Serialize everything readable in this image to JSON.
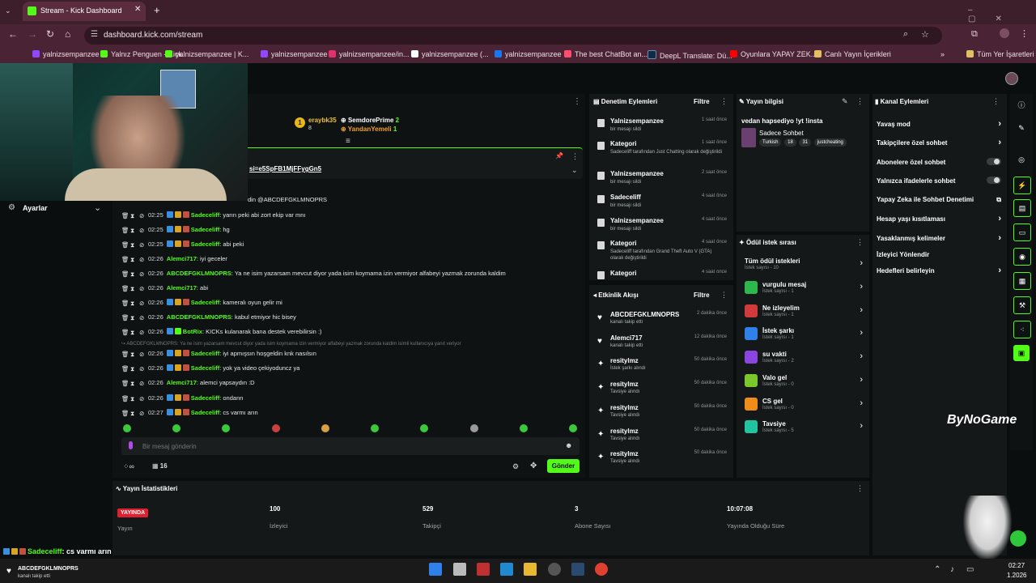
{
  "browser": {
    "tab_title": "Stream - Kick Dashboard",
    "url": "dashboard.kick.com/stream",
    "bookmarks": [
      {
        "label": "yalnizsempanzee",
        "color": "#9146ff"
      },
      {
        "label": "Yalnız Penguen - Kick",
        "color": "#53fc18"
      },
      {
        "label": "yalnizsempanzee | K...",
        "color": "#53fc18"
      },
      {
        "label": "yalnizsempanzee",
        "color": "#9146ff"
      },
      {
        "label": "yalnizsempanzee/in...",
        "color": "#e1306c"
      },
      {
        "label": "yalnizsempanzee (...",
        "color": "#ffffff"
      },
      {
        "label": "yalnizsempanzee",
        "color": "#1877f2"
      },
      {
        "label": "The best ChatBot an...",
        "color": "#ff4d6d"
      },
      {
        "label": "DeepL Translate: Dü...",
        "color": "#0f2b46"
      },
      {
        "label": "Oyunlara YAPAY ZEK...",
        "color": "#ff0000"
      },
      {
        "label": "Canlı Yayın İçerikleri",
        "color": "#e0c060"
      }
    ],
    "all_bookmarks": "Tüm Yer İşaretleri"
  },
  "left_panel": {
    "settings": "Ayarlar"
  },
  "chat": {
    "top_gifters": [
      {
        "name": "eraybk35",
        "count": "8",
        "color": "#e8c03a"
      },
      {
        "name": "SemdorePrime",
        "count": "2",
        "color": "#ffffff"
      },
      {
        "name": "YandanYemeli",
        "count": "1",
        "color": "#f0a030"
      }
    ],
    "pinned_link": "si=e5SpFB1MjFFygGn5",
    "reply_line": "din @ABCDEFGKLMNOPRS",
    "messages": [
      {
        "time": "02:25",
        "user": "Sadeceliff",
        "color": "#53fc18",
        "text": ": yarın peki abi zort ekip var mnı"
      },
      {
        "time": "02:25",
        "user": "Sadeceliff",
        "color": "#53fc18",
        "text": ": hg"
      },
      {
        "time": "02:25",
        "user": "Sadeceliff",
        "color": "#53fc18",
        "text": ": abi peki"
      },
      {
        "time": "02:26",
        "user": "Alemci717",
        "color": "#53fc18",
        "text": ": iyi geceler"
      },
      {
        "time": "02:26",
        "user": "ABCDEFGKLMNOPRS",
        "color": "#53fc18",
        "text": ": Ya ne isim yazarsam mevcut diyor yada isim koymama izin vermiyor alfabeyi yazmak zorunda kaldim"
      },
      {
        "time": "02:26",
        "user": "Alemci717",
        "color": "#53fc18",
        "text": ": abi"
      },
      {
        "time": "02:26",
        "user": "Sadeceliff",
        "color": "#53fc18",
        "text": ": kameralı oyun gelir mi"
      },
      {
        "time": "02:26",
        "user": "ABCDEFGKLMNOPRS",
        "color": "#53fc18",
        "text": ": kabul etmiyor hic bisey"
      },
      {
        "time": "02:26",
        "user": "BotRix",
        "color": "#53fc18",
        "text": ": KICKs kulanarak bana destek verebilirsin :)"
      },
      {
        "time": "02:26",
        "user": "Sadeceliff",
        "color": "#53fc18",
        "text": ": iyi apmışsın hoşgeldin knk nasılsın"
      },
      {
        "time": "02:26",
        "user": "Sadeceliff",
        "color": "#53fc18",
        "text": ": yok ya video çekiyoduncz ya"
      },
      {
        "time": "02:26",
        "user": "Alemci717",
        "color": "#53fc18",
        "text": ": alemci yapsaydın :D"
      },
      {
        "time": "02:26",
        "user": "Sadeceliff",
        "color": "#53fc18",
        "text": ": ondann"
      },
      {
        "time": "02:27",
        "user": "Sadeceliff",
        "color": "#53fc18",
        "text": ": cs varmı arın"
      }
    ],
    "reply_context": "ABCDEFGKLMNOPRS: Ya ne isim yazarsam mevcut diyor yada isim koymama izin vermiyor alfabeyi yazmak zorunda kaldim isimli kullanıcıya yanıt veriyor",
    "input_placeholder": "Bir mesaj gönderin",
    "viewer_count": "16",
    "send_label": "Gönder"
  },
  "moderation": {
    "title": "Denetim Eylemleri",
    "filter": "Filtre",
    "items": [
      {
        "user": "Yalnizsempanzee",
        "time": "1 saat önce",
        "desc": "bir mesajı sildi",
        "type": "trash"
      },
      {
        "user": "Kategori",
        "time": "1 saat önce",
        "desc": "Sadeceliff tarafından Just Chatting olarak değiştirildi",
        "type": "cat"
      },
      {
        "user": "Yalnizsempanzee",
        "time": "2 saat önce",
        "desc": "bir mesajı sildi",
        "type": "trash"
      },
      {
        "user": "Sadeceliff",
        "time": "4 saat önce",
        "desc": "bir mesajı sildi",
        "type": "trash"
      },
      {
        "user": "Yalnizsempanzee",
        "time": "4 saat önce",
        "desc": "bir mesajı sildi",
        "type": "trash"
      },
      {
        "user": "Kategori",
        "time": "4 saat önce",
        "desc": "Sadeceliff tarafından Grand Theft Auto V (GTA) olarak değiştirildi",
        "type": "cat"
      },
      {
        "user": "Kategori",
        "time": "4 saat önce",
        "desc": "",
        "type": "cat"
      }
    ]
  },
  "activity": {
    "title": "Etkinlik Akışı",
    "filter": "Filtre",
    "items": [
      {
        "user": "ABCDEFGKLMNOPRS",
        "time": "2 dakika önce",
        "desc": "kanalı takip etti",
        "icon": "♥"
      },
      {
        "user": "Alemci717",
        "time": "12 dakika önce",
        "desc": "kanalı takip etti",
        "icon": "♥"
      },
      {
        "user": "resitylmz",
        "time": "50 dakika önce",
        "desc": "İstek şarkı alındı",
        "icon": "✦"
      },
      {
        "user": "resitylmz",
        "time": "50 dakika önce",
        "desc": "Tavsiye alındı",
        "icon": "✦"
      },
      {
        "user": "resitylmz",
        "time": "50 dakika önce",
        "desc": "Tavsiye alındı",
        "icon": "✦"
      },
      {
        "user": "resitylmz",
        "time": "50 dakika önce",
        "desc": "Tavsiye alındı",
        "icon": "✦"
      },
      {
        "user": "resitylmz",
        "time": "50 dakika önce",
        "desc": "Tavsiye alındı",
        "icon": "✦"
      }
    ]
  },
  "stream_info": {
    "title": "Yayın bilgisi",
    "stream_title": "vedan hapsediyo !yt !insta",
    "category": "Sadece Sohbet",
    "tags": [
      "Turkish",
      "18",
      "31",
      "justcheating"
    ]
  },
  "rewards": {
    "title": "Ödül istek sırası",
    "items": [
      {
        "name": "Tüm ödül istekleri",
        "desc": "İstek sayısı - 10",
        "color": ""
      },
      {
        "name": "vurgulu mesaj",
        "desc": "İstek sayısı - 1",
        "color": "#2db84d"
      },
      {
        "name": "Ne izleyelim",
        "desc": "İstek sayısı - 1",
        "color": "#d23b3b"
      },
      {
        "name": "İstek şarkı",
        "desc": "İstek sayısı - 1",
        "color": "#2f80e8"
      },
      {
        "name": "su vakti",
        "desc": "İstek sayısı - 2",
        "color": "#8b45e0"
      },
      {
        "name": "Valo gel",
        "desc": "İstek sayısı - 0",
        "color": "#7cc82a"
      },
      {
        "name": "CS gel",
        "desc": "İstek sayısı - 0",
        "color": "#f08c1a"
      },
      {
        "name": "Tavsiye",
        "desc": "İstek sayısı - 5",
        "color": "#22c4a0"
      }
    ]
  },
  "channel_actions": {
    "title": "Kanal Eylemleri",
    "items": [
      {
        "label": "Yavaş mod",
        "control": "arrow"
      },
      {
        "label": "Takipçilere özel sohbet",
        "control": "arrow"
      },
      {
        "label": "Abonelere özel sohbet",
        "control": "toggle"
      },
      {
        "label": "Yalnızca ifadelerle sohbet",
        "control": "toggle"
      },
      {
        "label": "Yapay Zeka ile Sohbet Denetimi",
        "control": "link"
      },
      {
        "label": "Hesap yaşı kısıtlaması",
        "control": "arrow"
      },
      {
        "label": "Yasaklanmış kelimeler",
        "control": "arrow"
      },
      {
        "label": "İzleyici Yönlendir",
        "control": "none"
      },
      {
        "label": "Hedefleri belirleyin",
        "control": "arrow"
      }
    ]
  },
  "stats": {
    "title": "Yayın İstatistikleri",
    "live_badge": "YAYINDA",
    "items": [
      {
        "value": "",
        "label": "Yayın"
      },
      {
        "value": "100",
        "label": "İzleyici"
      },
      {
        "value": "529",
        "label": "Takipçi"
      },
      {
        "value": "3",
        "label": "Abone Sayısı"
      },
      {
        "value": "10:07:08",
        "label": "Yayında Olduğu Süre"
      }
    ]
  },
  "overlay": {
    "watermark": "ByNoGame",
    "chat_overlay_user": "Sadeceliff",
    "chat_overlay_text": ": cs varmı arın",
    "follow_user": "ABCDEFGKLMNOPRS",
    "follow_text": "kanalı takip etti",
    "clock_time": "02:27",
    "clock_date": "1.2026"
  },
  "colors": {
    "accent": "#53fc18",
    "live": "#e0202e"
  }
}
